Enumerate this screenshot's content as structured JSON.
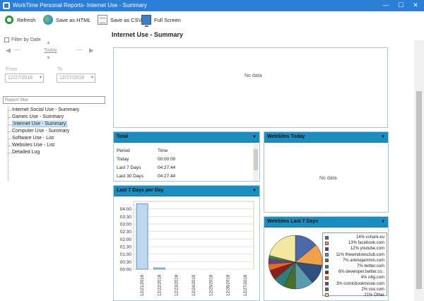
{
  "window": {
    "title": "WorkTime Personal Reports- Internet Use - Summary",
    "minimize": "—",
    "maximize": "☐",
    "close": "✕"
  },
  "toolbar": {
    "refresh": "Refresh",
    "save_html": "Save as HTML",
    "save_csv": "Save as CSV",
    "full_screen": "Full Screen"
  },
  "filter": {
    "filter_by_date": "Filter by Date",
    "today": "Today",
    "from_label": "From",
    "to_label": "To",
    "from_date": "12/27/2018",
    "to_date": "12/27/2018",
    "report_filter_placeholder": "Report filter"
  },
  "tree": [
    {
      "label": "Internet Social Use - Summary",
      "selected": false
    },
    {
      "label": "Games Use - Summary",
      "selected": false
    },
    {
      "label": "Internet Use - Summary",
      "selected": true
    },
    {
      "label": "Computer Use - Summary",
      "selected": false
    },
    {
      "label": "Software Use - List",
      "selected": false
    },
    {
      "label": "Websites Use - List",
      "selected": false
    },
    {
      "label": "Detailed Log",
      "selected": false
    }
  ],
  "main": {
    "page_title": "Internet Use - Summary",
    "no_data": "No data"
  },
  "total_panel": {
    "title": "Total",
    "col_period": "Period",
    "col_time": "Time",
    "rows": [
      {
        "period": "Today",
        "time": "00:00:00"
      },
      {
        "period": "Last 7 Days",
        "time": "04:27:44"
      },
      {
        "period": "Last 30 Days",
        "time": "04:27:44"
      }
    ]
  },
  "websites_today": {
    "title": "WebSites Today",
    "no_data": "No data"
  },
  "bar_panel": {
    "title": "Last 7 Days per Day"
  },
  "pie_panel": {
    "title": "WebSites Last 7 Days"
  },
  "colors": {
    "titlebar": "#2b7fd6",
    "panel_header": "#1a8ec0",
    "bar_fill": "#bdd7ee",
    "bar_stroke": "#4a7fb5",
    "selection": "#cce4f7"
  },
  "chart_data": [
    {
      "type": "bar",
      "title": "Last 7 Days per Day",
      "categories": [
        "12/21/2018",
        "12/22/2018",
        "12/23/2018",
        "12/24/2018",
        "12/25/2018",
        "12/26/2018",
        "12/27/2018"
      ],
      "values": [
        4.35,
        0.09,
        0,
        0,
        0,
        0,
        0
      ],
      "unit": "hours",
      "yticks": [
        "00:00",
        "00:30",
        "01:00",
        "01:30",
        "02:00",
        "02:30",
        "03:00",
        "03:30",
        "04:00"
      ],
      "ylim": [
        0,
        4.5
      ],
      "grid": true
    },
    {
      "type": "pie",
      "title": "WebSites Last 7 Days",
      "slices": [
        {
          "label": "vshare.eu",
          "percent": 14,
          "display": "14% vshare.eu",
          "color": "#4c6aa8"
        },
        {
          "label": "facebook.com",
          "percent": 13,
          "display": "13% facebook.com",
          "color": "#f0a04b"
        },
        {
          "label": "youtube.com",
          "percent": 12,
          "display": "12% youtube.com",
          "color": "#2f4f7f"
        },
        {
          "label": "thewindowsclub.com",
          "percent": 11,
          "display": "11% thewindowsclub.com",
          "color": "#5b9bb0"
        },
        {
          "label": "animejammin.com",
          "percent": 7,
          "display": "7% animejammin.com",
          "color": "#4a6f2a"
        },
        {
          "label": "twitter.com",
          "percent": 7,
          "display": "7% twitter.com",
          "color": "#2e7d7a"
        },
        {
          "label": "developer.twitter.co..",
          "percent": 6,
          "display": "6% developer.twitter.co..",
          "color": "#8b1f1f"
        },
        {
          "label": "n4g.com",
          "percent": 4,
          "display": "4% n4g.com",
          "color": "#e56b1f"
        },
        {
          "label": "comicbookmovie.com",
          "percent": 3,
          "display": "3% comicbookmovie.com",
          "color": "#6b3f8f"
        },
        {
          "label": "vox.com",
          "percent": 2,
          "display": "2% vox.com",
          "color": "#3a8a3a"
        },
        {
          "label": "Other",
          "percent": 21,
          "display": "21% Other",
          "color": "#f4e8a0"
        }
      ]
    }
  ]
}
